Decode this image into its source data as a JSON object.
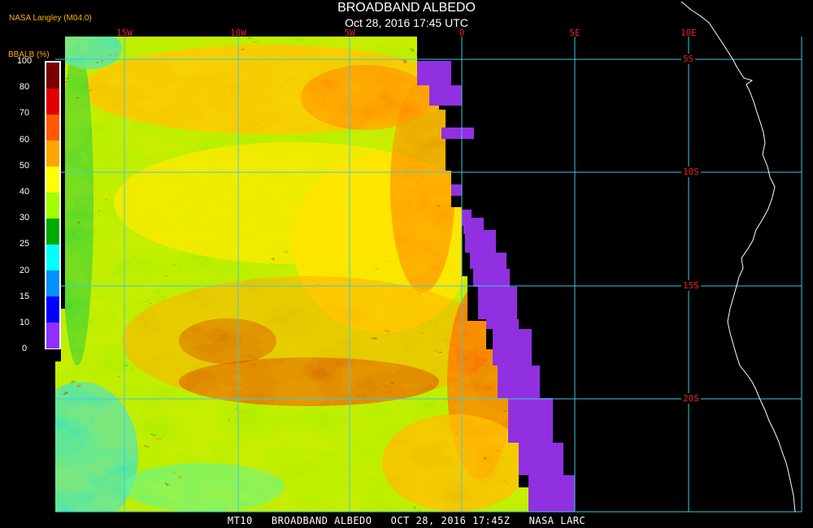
{
  "title": "BROADBAND ALBEDO",
  "datetime": "Oct 28, 2016 17:45 UTC",
  "producer": "NASA Langley (M04.0)",
  "bottom_caption": "MT10   BROADBAND ALBEDO   OCT 28, 2016 17:45Z   NASA LARC",
  "legend": {
    "title": "BBALB (%)",
    "ticks": [
      "100",
      "80",
      "70",
      "60",
      "50",
      "40",
      "30",
      "25",
      "20",
      "15",
      "10",
      "0"
    ],
    "colors": [
      "#7a0000",
      "#e00000",
      "#ff5a00",
      "#ffa500",
      "#ffff00",
      "#a0ff00",
      "#00aa00",
      "#00ffff",
      "#0090ff",
      "#0000ff",
      "#9030ff"
    ]
  },
  "grid": {
    "lon_labels": [
      "15W",
      "10W",
      "5W",
      "0",
      "5E",
      "10E"
    ],
    "lat_labels": [
      "5S",
      "10S",
      "15S",
      "20S"
    ],
    "line_color": "#40c8e0",
    "label_color": "#e8202a"
  }
}
